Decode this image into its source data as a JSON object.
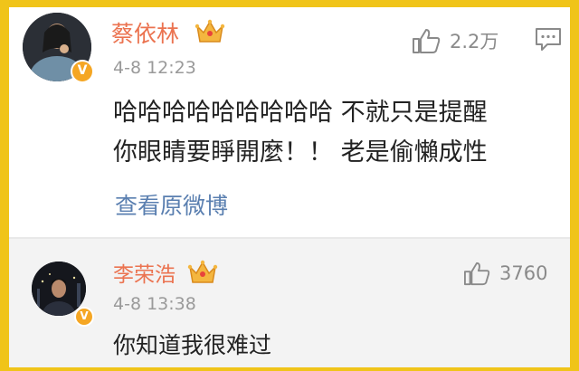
{
  "comments": [
    {
      "author": "蔡依林",
      "time": "4-8 12:23",
      "text_lines": [
        "哈哈哈哈哈哈哈哈哈 不就只是提醒",
        "你眼睛要睜開麼！！ 老是偷懶成性"
      ],
      "view_original": "查看原微博",
      "likes": "2.2万",
      "badge": "V",
      "icons": [
        "crown-icon",
        "thumbs-up-icon",
        "comment-icon"
      ]
    },
    {
      "author": "李荣浩",
      "time": "4-8 13:38",
      "text": "你知道我很难过",
      "likes": "3760",
      "badge": "V",
      "icons": [
        "crown-icon",
        "thumbs-up-icon"
      ]
    }
  ],
  "colors": {
    "border": "#f0c419",
    "name": "#eb7350",
    "link": "#5a7fb0",
    "badge": "#f5a623"
  }
}
